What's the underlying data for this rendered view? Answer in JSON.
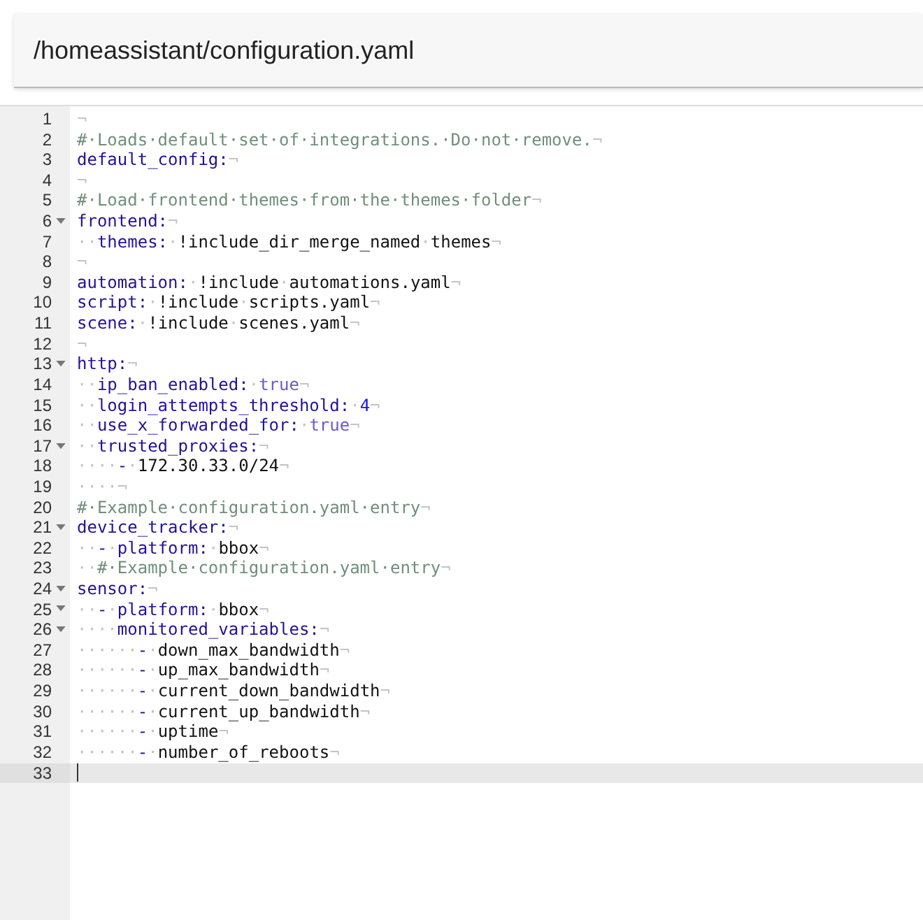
{
  "title": "/homeassistant/configuration.yaml",
  "lines": [
    {
      "number": "1",
      "fold": false,
      "active": false,
      "tokens": [
        {
          "kind": "ws",
          "text": "¬"
        }
      ]
    },
    {
      "number": "2",
      "fold": false,
      "active": false,
      "tokens": [
        {
          "kind": "comment",
          "text": "#·Loads·default·set·of·integrations.·Do·not·remove."
        },
        {
          "kind": "ws",
          "text": "¬"
        }
      ]
    },
    {
      "number": "3",
      "fold": false,
      "active": false,
      "tokens": [
        {
          "kind": "key",
          "text": "default_config:"
        },
        {
          "kind": "ws",
          "text": "¬"
        }
      ]
    },
    {
      "number": "4",
      "fold": false,
      "active": false,
      "tokens": [
        {
          "kind": "ws",
          "text": "¬"
        }
      ]
    },
    {
      "number": "5",
      "fold": false,
      "active": false,
      "tokens": [
        {
          "kind": "comment",
          "text": "#·Load·frontend·themes·from·the·themes·folder"
        },
        {
          "kind": "ws",
          "text": "¬"
        }
      ]
    },
    {
      "number": "6",
      "fold": true,
      "active": false,
      "tokens": [
        {
          "kind": "key",
          "text": "frontend:"
        },
        {
          "kind": "ws",
          "text": "¬"
        }
      ]
    },
    {
      "number": "7",
      "fold": false,
      "active": false,
      "tokens": [
        {
          "kind": "ws",
          "text": "··"
        },
        {
          "kind": "key",
          "text": "themes:"
        },
        {
          "kind": "ws",
          "text": "·"
        },
        {
          "kind": "plain",
          "text": "!include_dir_merge_named"
        },
        {
          "kind": "ws",
          "text": "·"
        },
        {
          "kind": "plain",
          "text": "themes"
        },
        {
          "kind": "ws",
          "text": "¬"
        }
      ]
    },
    {
      "number": "8",
      "fold": false,
      "active": false,
      "tokens": [
        {
          "kind": "ws",
          "text": "¬"
        }
      ]
    },
    {
      "number": "9",
      "fold": false,
      "active": false,
      "tokens": [
        {
          "kind": "key",
          "text": "automation:"
        },
        {
          "kind": "ws",
          "text": "·"
        },
        {
          "kind": "plain",
          "text": "!include"
        },
        {
          "kind": "ws",
          "text": "·"
        },
        {
          "kind": "plain",
          "text": "automations.yaml"
        },
        {
          "kind": "ws",
          "text": "¬"
        }
      ]
    },
    {
      "number": "10",
      "fold": false,
      "active": false,
      "tokens": [
        {
          "kind": "key",
          "text": "script:"
        },
        {
          "kind": "ws",
          "text": "·"
        },
        {
          "kind": "plain",
          "text": "!include"
        },
        {
          "kind": "ws",
          "text": "·"
        },
        {
          "kind": "plain",
          "text": "scripts.yaml"
        },
        {
          "kind": "ws",
          "text": "¬"
        }
      ]
    },
    {
      "number": "11",
      "fold": false,
      "active": false,
      "tokens": [
        {
          "kind": "key",
          "text": "scene:"
        },
        {
          "kind": "ws",
          "text": "·"
        },
        {
          "kind": "plain",
          "text": "!include"
        },
        {
          "kind": "ws",
          "text": "·"
        },
        {
          "kind": "plain",
          "text": "scenes.yaml"
        },
        {
          "kind": "ws",
          "text": "¬"
        }
      ]
    },
    {
      "number": "12",
      "fold": false,
      "active": false,
      "tokens": [
        {
          "kind": "ws",
          "text": "¬"
        }
      ]
    },
    {
      "number": "13",
      "fold": true,
      "active": false,
      "tokens": [
        {
          "kind": "key",
          "text": "http:"
        },
        {
          "kind": "ws",
          "text": "¬"
        }
      ]
    },
    {
      "number": "14",
      "fold": false,
      "active": false,
      "tokens": [
        {
          "kind": "ws",
          "text": "··"
        },
        {
          "kind": "key",
          "text": "ip_ban_enabled:"
        },
        {
          "kind": "ws",
          "text": "·"
        },
        {
          "kind": "bool",
          "text": "true"
        },
        {
          "kind": "ws",
          "text": "¬"
        }
      ]
    },
    {
      "number": "15",
      "fold": false,
      "active": false,
      "tokens": [
        {
          "kind": "ws",
          "text": "··"
        },
        {
          "kind": "key",
          "text": "login_attempts_threshold:"
        },
        {
          "kind": "ws",
          "text": "·"
        },
        {
          "kind": "number",
          "text": "4"
        },
        {
          "kind": "ws",
          "text": "¬"
        }
      ]
    },
    {
      "number": "16",
      "fold": false,
      "active": false,
      "tokens": [
        {
          "kind": "ws",
          "text": "··"
        },
        {
          "kind": "key",
          "text": "use_x_forwarded_for:"
        },
        {
          "kind": "ws",
          "text": "·"
        },
        {
          "kind": "bool",
          "text": "true"
        },
        {
          "kind": "ws",
          "text": "¬"
        }
      ]
    },
    {
      "number": "17",
      "fold": true,
      "active": false,
      "tokens": [
        {
          "kind": "ws",
          "text": "··"
        },
        {
          "kind": "key",
          "text": "trusted_proxies:"
        },
        {
          "kind": "ws",
          "text": "¬"
        }
      ]
    },
    {
      "number": "18",
      "fold": false,
      "active": false,
      "tokens": [
        {
          "kind": "ws",
          "text": "····"
        },
        {
          "kind": "key",
          "text": "-"
        },
        {
          "kind": "ws",
          "text": "·"
        },
        {
          "kind": "plain",
          "text": "172.30.33.0/24"
        },
        {
          "kind": "ws",
          "text": "¬"
        }
      ]
    },
    {
      "number": "19",
      "fold": false,
      "active": false,
      "tokens": [
        {
          "kind": "ws",
          "text": "····¬"
        }
      ]
    },
    {
      "number": "20",
      "fold": false,
      "active": false,
      "tokens": [
        {
          "kind": "comment",
          "text": "#·Example·configuration.yaml·entry"
        },
        {
          "kind": "ws",
          "text": "¬"
        }
      ]
    },
    {
      "number": "21",
      "fold": true,
      "active": false,
      "tokens": [
        {
          "kind": "key",
          "text": "device_tracker:"
        },
        {
          "kind": "ws",
          "text": "¬"
        }
      ]
    },
    {
      "number": "22",
      "fold": false,
      "active": false,
      "tokens": [
        {
          "kind": "ws",
          "text": "··"
        },
        {
          "kind": "key",
          "text": "-"
        },
        {
          "kind": "ws",
          "text": "·"
        },
        {
          "kind": "key",
          "text": "platform:"
        },
        {
          "kind": "ws",
          "text": "·"
        },
        {
          "kind": "plain",
          "text": "bbox"
        },
        {
          "kind": "ws",
          "text": "¬"
        }
      ]
    },
    {
      "number": "23",
      "fold": false,
      "active": false,
      "tokens": [
        {
          "kind": "ws",
          "text": "··"
        },
        {
          "kind": "comment",
          "text": "#·Example·configuration.yaml·entry"
        },
        {
          "kind": "ws",
          "text": "¬"
        }
      ]
    },
    {
      "number": "24",
      "fold": true,
      "active": false,
      "tokens": [
        {
          "kind": "key",
          "text": "sensor:"
        },
        {
          "kind": "ws",
          "text": "¬"
        }
      ]
    },
    {
      "number": "25",
      "fold": true,
      "active": false,
      "tokens": [
        {
          "kind": "ws",
          "text": "··"
        },
        {
          "kind": "key",
          "text": "-"
        },
        {
          "kind": "ws",
          "text": "·"
        },
        {
          "kind": "key",
          "text": "platform:"
        },
        {
          "kind": "ws",
          "text": "·"
        },
        {
          "kind": "plain",
          "text": "bbox"
        },
        {
          "kind": "ws",
          "text": "¬"
        }
      ]
    },
    {
      "number": "26",
      "fold": true,
      "active": false,
      "tokens": [
        {
          "kind": "ws",
          "text": "····"
        },
        {
          "kind": "key",
          "text": "monitored_variables:"
        },
        {
          "kind": "ws",
          "text": "¬"
        }
      ]
    },
    {
      "number": "27",
      "fold": false,
      "active": false,
      "tokens": [
        {
          "kind": "ws",
          "text": "······"
        },
        {
          "kind": "key",
          "text": "-"
        },
        {
          "kind": "ws",
          "text": "·"
        },
        {
          "kind": "plain",
          "text": "down_max_bandwidth"
        },
        {
          "kind": "ws",
          "text": "¬"
        }
      ]
    },
    {
      "number": "28",
      "fold": false,
      "active": false,
      "tokens": [
        {
          "kind": "ws",
          "text": "······"
        },
        {
          "kind": "key",
          "text": "-"
        },
        {
          "kind": "ws",
          "text": "·"
        },
        {
          "kind": "plain",
          "text": "up_max_bandwidth"
        },
        {
          "kind": "ws",
          "text": "¬"
        }
      ]
    },
    {
      "number": "29",
      "fold": false,
      "active": false,
      "tokens": [
        {
          "kind": "ws",
          "text": "······"
        },
        {
          "kind": "key",
          "text": "-"
        },
        {
          "kind": "ws",
          "text": "·"
        },
        {
          "kind": "plain",
          "text": "current_down_bandwidth"
        },
        {
          "kind": "ws",
          "text": "¬"
        }
      ]
    },
    {
      "number": "30",
      "fold": false,
      "active": false,
      "tokens": [
        {
          "kind": "ws",
          "text": "······"
        },
        {
          "kind": "key",
          "text": "-"
        },
        {
          "kind": "ws",
          "text": "·"
        },
        {
          "kind": "plain",
          "text": "current_up_bandwidth"
        },
        {
          "kind": "ws",
          "text": "¬"
        }
      ]
    },
    {
      "number": "31",
      "fold": false,
      "active": false,
      "tokens": [
        {
          "kind": "ws",
          "text": "······"
        },
        {
          "kind": "key",
          "text": "-"
        },
        {
          "kind": "ws",
          "text": "·"
        },
        {
          "kind": "plain",
          "text": "uptime"
        },
        {
          "kind": "ws",
          "text": "¬"
        }
      ]
    },
    {
      "number": "32",
      "fold": false,
      "active": false,
      "tokens": [
        {
          "kind": "ws",
          "text": "······"
        },
        {
          "kind": "key",
          "text": "-"
        },
        {
          "kind": "ws",
          "text": "·"
        },
        {
          "kind": "plain",
          "text": "number_of_reboots"
        },
        {
          "kind": "ws",
          "text": "¬"
        }
      ]
    },
    {
      "number": "33",
      "fold": false,
      "active": true
    }
  ]
}
